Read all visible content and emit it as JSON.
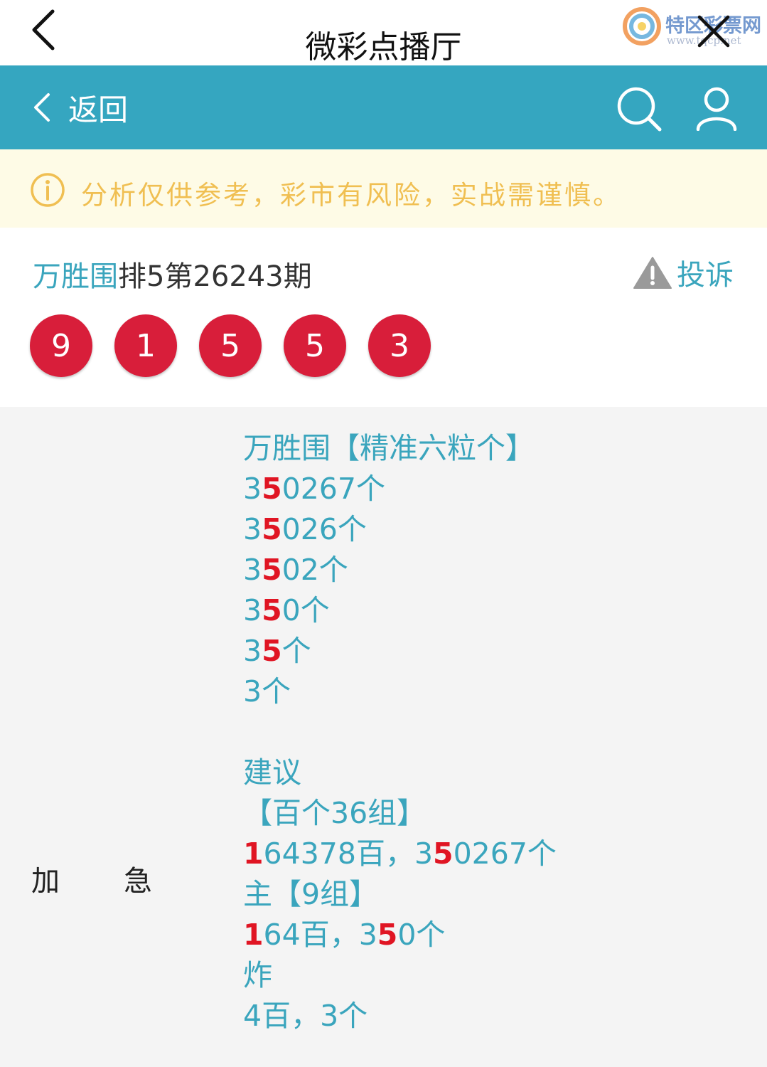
{
  "topbar": {
    "title": "微彩点播厅",
    "watermark_text": "特区彩票网",
    "watermark_sub": "www.tqcp.net"
  },
  "navbar": {
    "back_label": "返回"
  },
  "notice": {
    "text": "分析仅供参考，彩市有风险，实战需谨慎。",
    "color": "#f0bf52"
  },
  "card": {
    "brand": "万胜围",
    "issue": "排5第26243期",
    "report_label": "投诉",
    "balls": [
      "9",
      "1",
      "5",
      "5",
      "3"
    ],
    "ball_color": "#d81e3a"
  },
  "recommend": {
    "label_left": "加",
    "label_right": "急",
    "title": "万胜围【精准六粒个】",
    "six": {
      "a": "3",
      "hl": "5",
      "b": "0267个"
    },
    "five": {
      "a": "3",
      "hl": "5",
      "b": "026个"
    },
    "four": {
      "a": "3",
      "hl": "5",
      "b": "02个"
    },
    "three": {
      "a": "3",
      "hl": "5",
      "b": "0个"
    },
    "two": {
      "a": "3",
      "hl": "5",
      "b": "个"
    },
    "one": "3个",
    "advice_title": "建议",
    "group36_title": "【百个36组】",
    "group36": {
      "hl1": "1",
      "mid": "64378百，3",
      "hl2": "5",
      "end": "0267个"
    },
    "main_title": "主【9组】",
    "main": {
      "hl1": "1",
      "mid": "64百，3",
      "hl2": "5",
      "end": "0个"
    },
    "bomb_title": "炸",
    "bomb": "4百，3个",
    "brand_color": "#3aa5bd",
    "highlight_color": "#e01523"
  }
}
